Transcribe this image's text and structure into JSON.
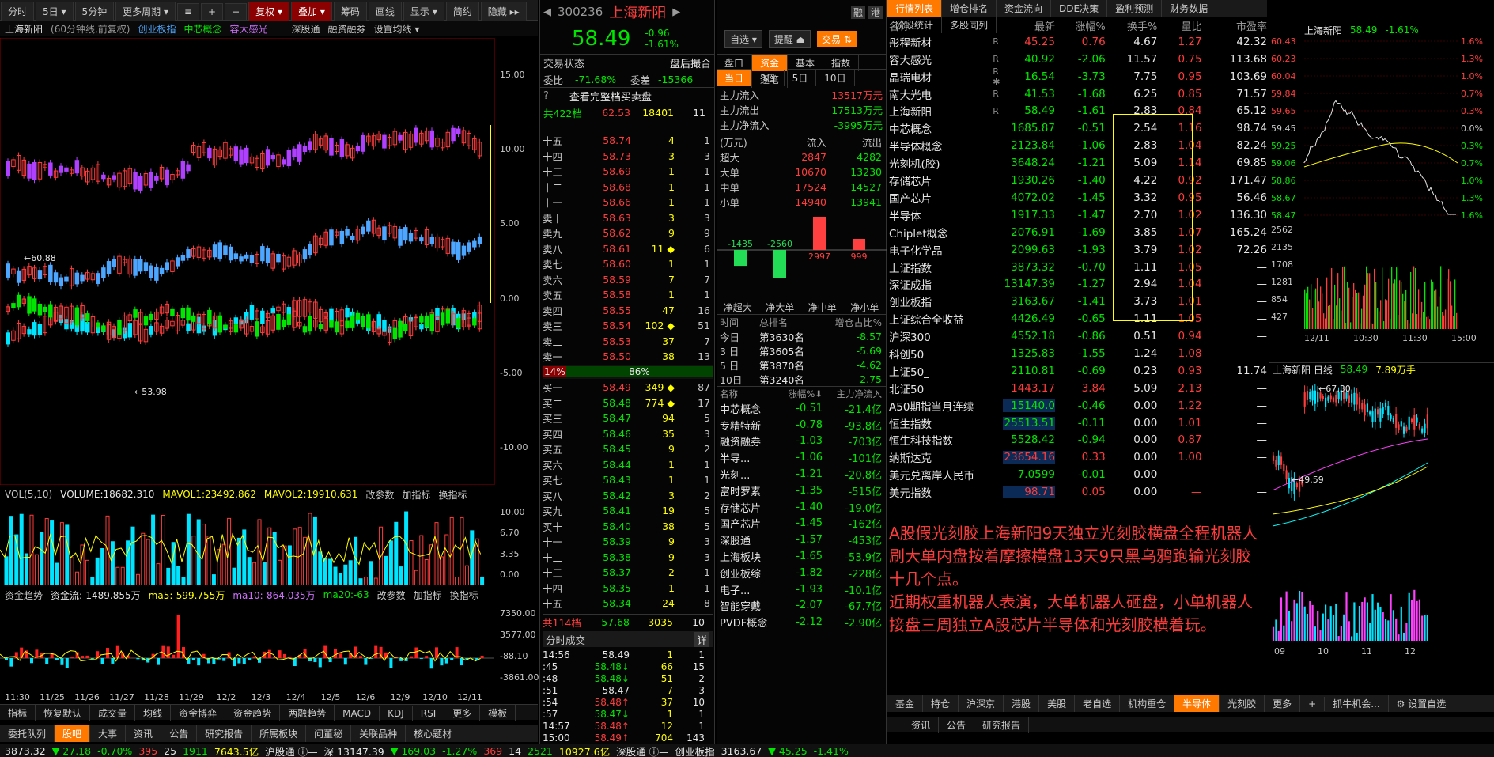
{
  "toolbar": {
    "items": [
      "分时",
      "5日 ▾",
      "5分钟",
      "更多周期 ▾"
    ],
    "icons": [
      "≡",
      "+",
      "−"
    ],
    "active": [
      "复权 ▾",
      "叠加 ▾"
    ],
    "items2": [
      "筹码",
      "画线",
      "显示 ▾",
      "简约",
      "隐藏 ▸▸"
    ]
  },
  "chart_header": {
    "name": "上海新阳",
    "period": "(60分钟线,前复权)",
    "overlays": [
      "创业板指",
      "中芯概念",
      "容大感光"
    ],
    "links": [
      "深股通",
      "融资融券",
      "设置均线 ▾"
    ]
  },
  "main_yaxis": [
    "15.00",
    "10.00",
    "5.00",
    "0.00",
    "-5.00",
    "-10.00"
  ],
  "main_marks": {
    "high": "←60.88",
    "low": "←53.98"
  },
  "vol_header": {
    "label": "VOL(5,10)",
    "volume": "VOLUME:18682.310",
    "ma1": "MAVOL1:23492.862",
    "ma2": "MAVOL2:19910.631",
    "links": [
      "改参数",
      "加指标",
      "换指标"
    ]
  },
  "vol_yaxis": [
    "10.00",
    "6.70",
    "3.35",
    "0.00"
  ],
  "fund_header": {
    "label": "资金趋势",
    "flow": "资金流:-1489.855万",
    "ma5": "ma5:-599.755万",
    "ma10": "ma10:-864.035万",
    "ma20": "ma20:-63",
    "links": [
      "改参数",
      "加指标",
      "换指标"
    ]
  },
  "fund_yaxis": [
    "7350.00",
    "3577.00",
    "-88.10",
    "-3861.00"
  ],
  "xaxis": [
    "11:30",
    "11/25",
    "11/26",
    "11/27",
    "11/28",
    "11/29",
    "12/2",
    "12/3",
    "12/4",
    "12/5",
    "12/6",
    "12/9",
    "12/10",
    "12/11"
  ],
  "indicator_tabs": [
    "指标",
    "恢复默认",
    "成交量",
    "均线",
    "资金博弈",
    "资金趋势",
    "两融趋势",
    "MACD",
    "KDJ",
    "RSI",
    "更多",
    "模板"
  ],
  "bottom_tabs": [
    "委托队列",
    "股吧",
    "大事",
    "资讯",
    "公告",
    "研究报告",
    "所属板块",
    "问董秘",
    "关联品种",
    "核心题材"
  ],
  "status_bar": [
    {
      "t": "3873.32",
      "c": "wht"
    },
    {
      "t": "▼ 27.18",
      "c": "grn"
    },
    {
      "t": "-0.70%",
      "c": "grn"
    },
    {
      "t": "395",
      "c": "red"
    },
    {
      "t": "25",
      "c": "wht"
    },
    {
      "t": "1911",
      "c": "grn"
    },
    {
      "t": "7643.5亿",
      "c": "yel"
    },
    {
      "t": "沪股通 ⓘ—",
      "c": "wht"
    },
    {
      "t": "深 13147.39",
      "c": "wht"
    },
    {
      "t": "▼ 169.03",
      "c": "grn"
    },
    {
      "t": "-1.27%",
      "c": "grn"
    },
    {
      "t": "369",
      "c": "red"
    },
    {
      "t": "14",
      "c": "wht"
    },
    {
      "t": "2521",
      "c": "grn"
    },
    {
      "t": "10927.6亿",
      "c": "yel"
    },
    {
      "t": "深股通 ⓘ—",
      "c": "wht"
    },
    {
      "t": "创业板指",
      "c": "wht"
    },
    {
      "t": "3163.67",
      "c": "wht"
    },
    {
      "t": "▼ 45.25",
      "c": "grn"
    },
    {
      "t": "-1.41%",
      "c": "grn"
    }
  ],
  "stock": {
    "code": "300236",
    "name": "上海新阳",
    "price": "58.49",
    "change": "-0.96",
    "pct": "-1.61%",
    "badges": [
      "融",
      "港"
    ],
    "btn1": "自选 ▾",
    "btn2": "提醒 ⏏",
    "btn3": "交易 ⇅"
  },
  "trade_state": {
    "label": "交易状态",
    "value": "盘后撮合",
    "wb_label": "委比",
    "wb": "-71.68%",
    "wc_label": "委差",
    "wc": "-15366",
    "full": "查看完整档买卖盘",
    "total_sell": "共422档",
    "total_sell_p": "62.53",
    "total_sell_v": "18401",
    "total_sell_m": "11"
  },
  "asks": [
    {
      "a": "十五",
      "p": "58.74",
      "v": "4",
      "m": "1"
    },
    {
      "a": "十四",
      "p": "58.73",
      "v": "3",
      "m": "3"
    },
    {
      "a": "十三",
      "p": "58.69",
      "v": "1",
      "m": "1"
    },
    {
      "a": "十二",
      "p": "58.68",
      "v": "1",
      "m": "1"
    },
    {
      "a": "十一",
      "p": "58.66",
      "v": "1",
      "m": "1"
    },
    {
      "a": "卖十",
      "p": "58.63",
      "v": "3",
      "m": "3"
    },
    {
      "a": "卖九",
      "p": "58.62",
      "v": "9",
      "m": "9"
    },
    {
      "a": "卖八",
      "p": "58.61",
      "v": "11 ◆",
      "m": "6"
    },
    {
      "a": "卖七",
      "p": "58.60",
      "v": "1",
      "m": "1"
    },
    {
      "a": "卖六",
      "p": "58.59",
      "v": "7",
      "m": "7"
    },
    {
      "a": "卖五",
      "p": "58.58",
      "v": "1",
      "m": "1"
    },
    {
      "a": "卖四",
      "p": "58.55",
      "v": "47",
      "m": "16"
    },
    {
      "a": "卖三",
      "p": "58.54",
      "v": "102 ◆",
      "m": "51"
    },
    {
      "a": "卖二",
      "p": "58.53",
      "v": "37",
      "m": "7"
    },
    {
      "a": "卖一",
      "p": "58.50",
      "v": "38",
      "m": "13"
    }
  ],
  "ratio": {
    "left": "14%",
    "right": "86%"
  },
  "bids": [
    {
      "a": "买一",
      "p": "58.49",
      "v": "349 ◆",
      "m": "87"
    },
    {
      "a": "买二",
      "p": "58.48",
      "v": "774 ◆",
      "m": "17"
    },
    {
      "a": "买三",
      "p": "58.47",
      "v": "94",
      "m": "5"
    },
    {
      "a": "买四",
      "p": "58.46",
      "v": "35",
      "m": "3"
    },
    {
      "a": "买五",
      "p": "58.45",
      "v": "9",
      "m": "2"
    },
    {
      "a": "买六",
      "p": "58.44",
      "v": "1",
      "m": "1"
    },
    {
      "a": "买七",
      "p": "58.43",
      "v": "1",
      "m": "1"
    },
    {
      "a": "买八",
      "p": "58.42",
      "v": "3",
      "m": "2"
    },
    {
      "a": "买九",
      "p": "58.41",
      "v": "19",
      "m": "5"
    },
    {
      "a": "买十",
      "p": "58.40",
      "v": "38",
      "m": "5"
    },
    {
      "a": "十一",
      "p": "58.39",
      "v": "9",
      "m": "3"
    },
    {
      "a": "十二",
      "p": "58.38",
      "v": "9",
      "m": "3"
    },
    {
      "a": "十三",
      "p": "58.37",
      "v": "2",
      "m": "1"
    },
    {
      "a": "十四",
      "p": "58.35",
      "v": "1",
      "m": "1"
    },
    {
      "a": "十五",
      "p": "58.34",
      "v": "24",
      "m": "8"
    }
  ],
  "total_buy": {
    "label": "共114档",
    "p": "57.68",
    "v": "3035",
    "m": "10"
  },
  "ticks_header": {
    "label": "分时成交",
    "btn": "详"
  },
  "ticks": [
    {
      "t": "14:56",
      "p": "58.49",
      "v": "1",
      "m": "1",
      "c": "wht"
    },
    {
      "t": ":45",
      "p": "58.48↓",
      "v": "66",
      "m": "15",
      "c": "grn"
    },
    {
      "t": ":48",
      "p": "58.48↓",
      "v": "51",
      "m": "2",
      "c": "grn"
    },
    {
      "t": ":51",
      "p": "58.47",
      "v": "7",
      "m": "3",
      "c": "wht"
    },
    {
      "t": ":54",
      "p": "58.48↑",
      "v": "37",
      "m": "10",
      "c": "red"
    },
    {
      "t": ":57",
      "p": "58.47↓",
      "v": "1",
      "m": "1",
      "c": "grn"
    },
    {
      "t": "14:57",
      "p": "58.48↑",
      "v": "12",
      "m": "1",
      "c": "red"
    },
    {
      "t": "15:00",
      "p": "58.49↑",
      "v": "704",
      "m": "143",
      "c": "red"
    }
  ],
  "fund_tabs": [
    "盘口",
    "资金",
    "基本",
    "指数",
    "明细",
    "逐笔"
  ],
  "day_tabs": [
    "当日",
    "3日",
    "5日",
    "10日"
  ],
  "main_flow": [
    {
      "l": "主力流入",
      "v": "13517万元",
      "c": "red"
    },
    {
      "l": "主力流出",
      "v": "17513万元",
      "c": "grn"
    },
    {
      "l": "主力净流入",
      "v": "-3995万元",
      "c": "grn"
    }
  ],
  "flow_table": {
    "unit": "(万元)",
    "in": "流入",
    "out": "流出",
    "rows": [
      {
        "l": "超大",
        "i": "2847",
        "o": "4282"
      },
      {
        "l": "大单",
        "i": "10670",
        "o": "13230"
      },
      {
        "l": "中单",
        "i": "17524",
        "o": "14527"
      },
      {
        "l": "小单",
        "i": "14940",
        "o": "13941"
      }
    ]
  },
  "net_bars": {
    "labels": [
      "净超大",
      "净大单",
      "净中单",
      "净小单"
    ],
    "values": [
      "-1435",
      "-2560",
      "2997",
      "999"
    ]
  },
  "rank": {
    "h": [
      "时间",
      "总排名",
      "增仓占比%"
    ],
    "rows": [
      {
        "t": "今日",
        "r": "第3630名",
        "v": "-8.57"
      },
      {
        "t": "3 日",
        "r": "第3605名",
        "v": "-5.69"
      },
      {
        "t": "5 日",
        "r": "第3870名",
        "v": "-4.62"
      },
      {
        "t": "10日",
        "r": "第3240名",
        "v": "-2.75"
      }
    ]
  },
  "sector": {
    "h": [
      "名称",
      "涨幅%⬇",
      "主力净流入"
    ],
    "rows": [
      {
        "n": "中芯概念",
        "p": "-0.51",
        "f": "-21.4亿"
      },
      {
        "n": "专精特新",
        "p": "-0.78",
        "f": "-93.8亿"
      },
      {
        "n": "融资融券",
        "p": "-1.03",
        "f": "-703亿"
      },
      {
        "n": "半导...",
        "p": "-1.06",
        "f": "-101亿"
      },
      {
        "n": "光刻...",
        "p": "-1.21",
        "f": "-20.8亿"
      },
      {
        "n": "富时罗素",
        "p": "-1.35",
        "f": "-515亿"
      },
      {
        "n": "存储芯片",
        "p": "-1.40",
        "f": "-19.0亿"
      },
      {
        "n": "国产芯片",
        "p": "-1.45",
        "f": "-162亿"
      },
      {
        "n": "深股通",
        "p": "-1.57",
        "f": "-453亿"
      },
      {
        "n": "上海板块",
        "p": "-1.65",
        "f": "-53.9亿"
      },
      {
        "n": "创业板综",
        "p": "-1.82",
        "f": "-228亿"
      },
      {
        "n": "电子...",
        "p": "-1.93",
        "f": "-10.1亿"
      },
      {
        "n": "智能穿戴",
        "p": "-2.07",
        "f": "-67.7亿"
      },
      {
        "n": "PVDF概念",
        "p": "-2.12",
        "f": "-2.90亿"
      }
    ]
  },
  "quote_tabs": [
    "行情列表",
    "增仓排名",
    "资金流向",
    "DDE决策",
    "盈利预测",
    "财务数据",
    "阶段统计",
    "多股同列"
  ],
  "quote_header": {
    "n": "名称",
    "b": "最新",
    "c": "涨幅%",
    "h": "换手%",
    "l": "量比",
    "pe": "市盈率"
  },
  "quotes": [
    {
      "n": "彤程新材",
      "flag": "R",
      "b": "45.25",
      "c": "0.76",
      "h": "4.67",
      "l": "1.27",
      "pe": "42.32",
      "up": true
    },
    {
      "n": "容大感光",
      "flag": "R",
      "b": "40.92",
      "c": "-2.06",
      "h": "11.57",
      "l": "0.75",
      "pe": "113.68",
      "up": false
    },
    {
      "n": "晶瑞电材",
      "flag": "R ✱",
      "b": "16.54",
      "c": "-3.73",
      "h": "7.75",
      "l": "0.95",
      "pe": "103.69",
      "up": false
    },
    {
      "n": "南大光电",
      "flag": "R",
      "b": "41.53",
      "c": "-1.68",
      "h": "6.25",
      "l": "0.85",
      "pe": "71.57",
      "up": false
    },
    {
      "n": "上海新阳",
      "flag": "R",
      "b": "58.49",
      "c": "-1.61",
      "h": "2.83",
      "l": "0.84",
      "pe": "65.12",
      "up": false
    },
    {
      "n": "中芯概念",
      "flag": "",
      "b": "1685.87",
      "c": "-0.51",
      "h": "2.54",
      "l": "1.16",
      "pe": "98.74",
      "up": false
    },
    {
      "n": "半导体概念",
      "flag": "",
      "b": "2123.84",
      "c": "-1.06",
      "h": "2.83",
      "l": "1.04",
      "pe": "82.24",
      "up": false
    },
    {
      "n": "光刻机(胶)",
      "flag": "",
      "b": "3648.24",
      "c": "-1.21",
      "h": "5.09",
      "l": "1.14",
      "pe": "69.85",
      "up": false
    },
    {
      "n": "存储芯片",
      "flag": "",
      "b": "1930.26",
      "c": "-1.40",
      "h": "4.22",
      "l": "0.92",
      "pe": "171.47",
      "up": false
    },
    {
      "n": "国产芯片",
      "flag": "",
      "b": "4072.02",
      "c": "-1.45",
      "h": "3.32",
      "l": "0.95",
      "pe": "56.46",
      "up": false
    },
    {
      "n": "半导体",
      "flag": "",
      "b": "1917.33",
      "c": "-1.47",
      "h": "2.70",
      "l": "1.02",
      "pe": "136.30",
      "up": false
    },
    {
      "n": "Chiplet概念",
      "flag": "",
      "b": "2076.91",
      "c": "-1.69",
      "h": "3.85",
      "l": "1.07",
      "pe": "165.24",
      "up": false
    },
    {
      "n": "电子化学品",
      "flag": "",
      "b": "2099.63",
      "c": "-1.93",
      "h": "3.79",
      "l": "1.02",
      "pe": "72.26",
      "up": false
    },
    {
      "n": "上证指数",
      "flag": "",
      "b": "3873.32",
      "c": "-0.70",
      "h": "1.11",
      "l": "1.05",
      "pe": "—",
      "up": false
    },
    {
      "n": "深证成指",
      "flag": "",
      "b": "13147.39",
      "c": "-1.27",
      "h": "2.94",
      "l": "1.04",
      "pe": "—",
      "up": false
    },
    {
      "n": "创业板指",
      "flag": "",
      "b": "3163.67",
      "c": "-1.41",
      "h": "3.73",
      "l": "1.01",
      "pe": "—",
      "up": false
    },
    {
      "n": "上证综合全收益",
      "flag": "",
      "b": "4426.49",
      "c": "-0.65",
      "h": "1.11",
      "l": "1.05",
      "pe": "—",
      "up": false
    },
    {
      "n": "沪深300",
      "flag": "",
      "b": "4552.18",
      "c": "-0.86",
      "h": "0.51",
      "l": "0.94",
      "pe": "—",
      "up": false
    },
    {
      "n": "科创50",
      "flag": "",
      "b": "1325.83",
      "c": "-1.55",
      "h": "1.24",
      "l": "1.08",
      "pe": "—",
      "up": false
    },
    {
      "n": "上证50_",
      "flag": "",
      "b": "2110.81",
      "c": "-0.69",
      "h": "0.23",
      "l": "0.93",
      "pe": "11.74",
      "up": false
    },
    {
      "n": "北证50",
      "flag": "",
      "b": "1443.17",
      "c": "3.84",
      "h": "5.09",
      "l": "2.13",
      "pe": "—",
      "up": true
    },
    {
      "n": "A50期指当月连续",
      "flag": "",
      "b": "15140.0",
      "c": "-0.46",
      "h": "0.00",
      "l": "1.22",
      "pe": "—",
      "up": false
    },
    {
      "n": "恒生指数",
      "flag": "",
      "b": "25513.51",
      "c": "-0.11",
      "h": "0.00",
      "l": "1.01",
      "pe": "—",
      "up": false
    },
    {
      "n": "恒生科技指数",
      "flag": "",
      "b": "5528.42",
      "c": "-0.94",
      "h": "0.00",
      "l": "0.87",
      "pe": "—",
      "up": false
    },
    {
      "n": "纳斯达克",
      "flag": "",
      "b": "23654.16",
      "c": "0.33",
      "h": "0.00",
      "l": "1.00",
      "pe": "—",
      "up": true
    },
    {
      "n": "美元兑离岸人民币",
      "flag": "",
      "b": "7.0599",
      "c": "-0.01",
      "h": "0.00",
      "l": "—",
      "pe": "—",
      "up": false
    },
    {
      "n": "美元指数",
      "flag": "",
      "b": "98.71",
      "c": "0.05",
      "h": "0.00",
      "l": "—",
      "pe": "—",
      "up": true
    }
  ],
  "note": "A股假光刻胶上海新阳9天独立光刻胶横盘全程机器人刷大单内盘按着摩擦横盘13天9只黑乌鸦跑输光刻胶十几个点。\n近期权重机器人表演，大单机器人砸盘，小单机器人接盘三周独立A股芯片半导体和光刻胶横着玩。",
  "mini": {
    "name": "上海新阳",
    "price": "58.49",
    "pct": "-1.61%",
    "left_axis": [
      "60.43",
      "60.23",
      "60.04",
      "59.84",
      "59.65",
      "59.45",
      "59.25",
      "59.06",
      "58.86",
      "58.67",
      "58.47"
    ],
    "right_axis": [
      "1.6%",
      "1.3%",
      "1.0%",
      "0.7%",
      "0.3%",
      "0.0%",
      "0.3%",
      "0.7%",
      "1.0%",
      "1.3%",
      "1.6%"
    ],
    "vol_axis": [
      "2562",
      "2135",
      "1708",
      "1281",
      "854",
      "427"
    ],
    "x": [
      "12/11",
      "10:30",
      "11:30",
      "15:00"
    ]
  },
  "daily": {
    "name": "上海新阳 日线",
    "price": "58.49",
    "vol": "7.89万手",
    "high": "←67.30",
    "low": "←49.59",
    "x": [
      "09",
      "10",
      "11",
      "12"
    ]
  },
  "sector_tabs": [
    "基金",
    "持仓",
    "沪深京",
    "港股",
    "美股",
    "老自选",
    "机构重仓",
    "半导体",
    "光刻胶",
    "更多",
    "+",
    "抓牛机会...",
    "⚙ 设置自选"
  ],
  "right_bottom_tabs": [
    "资讯",
    "公告",
    "研究报告"
  ]
}
